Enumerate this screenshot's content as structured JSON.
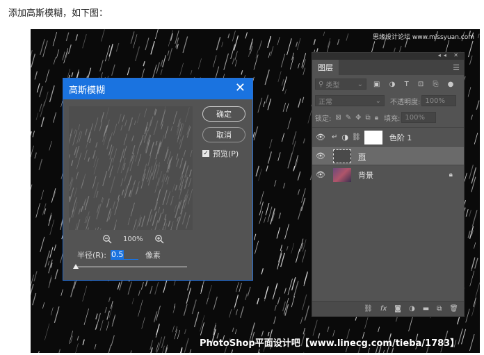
{
  "caption": "添加高斯模糊，如下图：",
  "watermark_top": "思缘设计论坛 www.missyuan.com",
  "watermark_bottom": "PhotoShop平面设计吧【www.linecg.com/tieba/1783】",
  "dialog": {
    "title": "高斯模糊",
    "ok_label": "确定",
    "cancel_label": "取消",
    "preview_label": "预览(P)",
    "preview_checked": true,
    "zoom": "100%",
    "radius_label": "半径(R):",
    "radius_value": "0.5",
    "radius_unit": "像素"
  },
  "layers_panel": {
    "tab": "图层",
    "filter_kind": "类型",
    "blend_mode": "正常",
    "opacity_label": "不透明度:",
    "opacity_value": "100%",
    "lock_label": "锁定:",
    "fill_label": "填充:",
    "fill_value": "100%",
    "layers": [
      {
        "name": "色阶 1",
        "type": "adjustment",
        "selected": false
      },
      {
        "name": "雨",
        "type": "pixel",
        "selected": true
      },
      {
        "name": "背景",
        "type": "background",
        "selected": false,
        "locked": true
      }
    ],
    "bottom_icons": [
      "link-icon",
      "fx-icon",
      "mask-icon",
      "adjustment-icon",
      "folder-icon",
      "new-layer-icon",
      "trash-icon"
    ]
  },
  "colors": {
    "accent": "#1a73e0",
    "panel_bg": "#535353",
    "photo_bg": "#0a0a0a"
  }
}
